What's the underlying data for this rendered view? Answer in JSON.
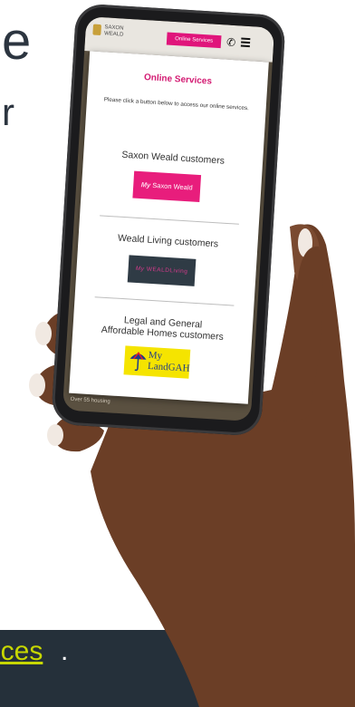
{
  "background": {
    "heading_fragment": "e",
    "heading_fragment2": "r",
    "footer_link": "ices",
    "footer_punct": "."
  },
  "phone": {
    "logo_line1": "SAXON",
    "logo_line2": "WEALD",
    "online_services_button": "Online Services",
    "below_text": "Over 55 housing",
    "icons": [
      "phone-icon",
      "menu-icon"
    ]
  },
  "modal": {
    "title": "Online Services",
    "intro": "Please click a button below to access our online services.",
    "sections": [
      {
        "label": "Saxon Weald customers",
        "logo_prefix": "My",
        "logo_text": "Saxon Weald"
      },
      {
        "label": "Weald Living customers",
        "logo_prefix": "My",
        "logo_text": "WEALDLiving"
      },
      {
        "label_line1": "Legal and General",
        "label_line2": "Affordable Homes customers",
        "logo_line1": "My",
        "logo_line2": "LandGAH"
      }
    ]
  },
  "colors": {
    "brand_pink": "#e0157b",
    "footer_bg": "#25303a",
    "link_yellow": "#c7d700",
    "gah_yellow": "#f5e400"
  }
}
